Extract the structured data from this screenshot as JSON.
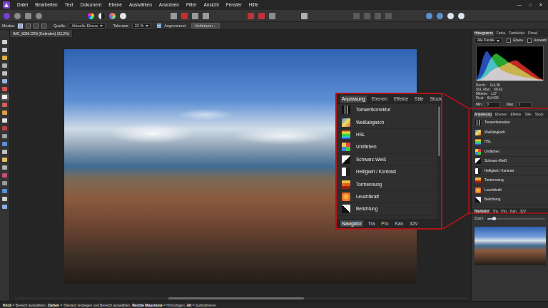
{
  "menu": [
    "Datei",
    "Bearbeiten",
    "Text",
    "Dokument",
    "Ebene",
    "Auswählen",
    "Anordnen",
    "Filter",
    "Ansicht",
    "Fenster",
    "Hilfe"
  ],
  "window_controls": [
    "—",
    "□",
    "✕"
  ],
  "context": {
    "mode_label": "Modus:",
    "modes": [
      {
        "selected": true
      },
      {
        "selected": false
      },
      {
        "selected": false
      },
      {
        "selected": false
      }
    ],
    "source_label": "Quelle:",
    "source_value": "Aktuelle Ebene",
    "tolerance_label": "Toleranz:",
    "tolerance_value": "22 %",
    "contiguous": {
      "label": "Angrenzend",
      "checked": true
    },
    "refine": "Verfeinern..."
  },
  "document_tab": {
    "title": "IMG_6056.CR3 (Geändert) (32,2%)"
  },
  "tools": [
    {
      "selected": false
    },
    {
      "selected": false
    },
    {
      "selected": false
    },
    {
      "selected": false
    },
    {
      "selected": false
    },
    {
      "selected": false
    },
    {
      "selected": false
    },
    {
      "selected": true
    },
    {
      "selected": false
    },
    {
      "selected": false
    },
    {
      "selected": false
    },
    {
      "selected": false
    },
    {
      "selected": false
    },
    {
      "selected": false
    },
    {
      "selected": false
    },
    {
      "selected": false
    },
    {
      "selected": false
    },
    {
      "selected": false
    },
    {
      "selected": false
    },
    {
      "selected": false
    },
    {
      "selected": false
    },
    {
      "selected": false
    }
  ],
  "histogram_panel": {
    "tabs": [
      {
        "label": "Histogramm",
        "selected": true
      },
      {
        "label": "Farbe",
        "selected": false
      },
      {
        "label": "Farbfelder",
        "selected": false
      },
      {
        "label": "Pinsel",
        "selected": false
      }
    ],
    "channel": "Alle Kanäle",
    "layer": {
      "label": "Ebene",
      "checked": false
    },
    "selection": {
      "label": "Auswahl",
      "checked": false
    },
    "series": [
      {
        "color": "#e0302a",
        "values": [
          1,
          2,
          4,
          8,
          12,
          18,
          25,
          30,
          34,
          38,
          40,
          42,
          45,
          48,
          52,
          55,
          58,
          60,
          62,
          60,
          55,
          50,
          45,
          40,
          35,
          30,
          25,
          20,
          15,
          10,
          6,
          3
        ]
      },
      {
        "color": "#2ec23a",
        "values": [
          2,
          5,
          10,
          18,
          30,
          45,
          60,
          70,
          78,
          82,
          80,
          75,
          70,
          66,
          60,
          55,
          52,
          48,
          45,
          40,
          36,
          32,
          28,
          24,
          20,
          16,
          12,
          9,
          6,
          4,
          3,
          2
        ]
      },
      {
        "color": "#2f5bd8",
        "values": [
          5,
          20,
          45,
          70,
          85,
          90,
          80,
          70,
          60,
          50,
          42,
          35,
          30,
          28,
          25,
          22,
          20,
          18,
          17,
          15,
          14,
          12,
          10,
          9,
          8,
          7,
          6,
          5,
          4,
          3,
          3,
          2
        ]
      }
    ],
    "stats": [
      {
        "label": "Durch.:",
        "value": "114,38"
      },
      {
        "label": "Std. Abw.:",
        "value": "68,42"
      },
      {
        "label": "Mittelw.:",
        "value": "117"
      },
      {
        "label": "Pixel:",
        "value": "614400"
      }
    ],
    "min": {
      "label": "Min:",
      "value": "0"
    },
    "max": {
      "label": "Max:",
      "value": "1"
    }
  },
  "adjustment_panel": {
    "tabs": [
      {
        "label": "Anpassung",
        "selected": true
      },
      {
        "label": "Ebenen",
        "selected": false
      },
      {
        "label": "Effekte",
        "selected": false
      },
      {
        "label": "Stile",
        "selected": false
      },
      {
        "label": "Stock",
        "selected": false
      }
    ],
    "items": [
      "Tonwertkorrektur",
      "Weißabgleich",
      "HSL",
      "Umfärben",
      "Schwarz-Weiß",
      "Helligkeit / Kontrast",
      "Tontrennung",
      "Leuchtkraft",
      "Belichtung"
    ]
  },
  "navigator_panel": {
    "tabs": [
      {
        "label": "Navigator",
        "selected": true
      },
      {
        "label": "Tra",
        "selected": false
      },
      {
        "label": "Pro",
        "selected": false
      },
      {
        "label": "Kan",
        "selected": false
      },
      {
        "label": "32V",
        "selected": false
      }
    ],
    "zoom_label": "Zoom:",
    "zoom_level": 0.12
  },
  "zoomed_panel": {
    "tabs": [
      {
        "label": "Anpassung",
        "selected": true
      },
      {
        "label": "Ebenen",
        "selected": false
      },
      {
        "label": "Effekte",
        "selected": false
      },
      {
        "label": "Stile",
        "selected": false
      },
      {
        "label": "Stock",
        "selected": false
      }
    ],
    "items": [
      "Tonwertkorrektur",
      "Weißabgleich",
      "HSL",
      "Umfärben",
      "Schwarz-Weiß",
      "Helligkeit / Kontrast",
      "Tontrennung",
      "Leuchtkraft",
      "Belichtung"
    ],
    "bottom_tabs": [
      {
        "label": "Navigator",
        "selected": true
      },
      {
        "label": "Tra",
        "selected": false
      },
      {
        "label": "Pro",
        "selected": false
      },
      {
        "label": "Kan",
        "selected": false
      },
      {
        "label": "32V",
        "selected": false
      }
    ]
  },
  "status_bar": [
    {
      "kind": "key",
      "text": "Klick"
    },
    {
      "kind": "text",
      "text": " = Bereich auswählen. "
    },
    {
      "kind": "key",
      "text": "Ziehen"
    },
    {
      "kind": "text",
      "text": " = Toleranz festlegen und Bereich auswählen. "
    },
    {
      "kind": "key",
      "text": "Rechte Maustaste"
    },
    {
      "kind": "text",
      "text": " = Hinzufügen. "
    },
    {
      "kind": "key",
      "text": "Alt"
    },
    {
      "kind": "text",
      "text": " = Subtrahieren."
    }
  ]
}
